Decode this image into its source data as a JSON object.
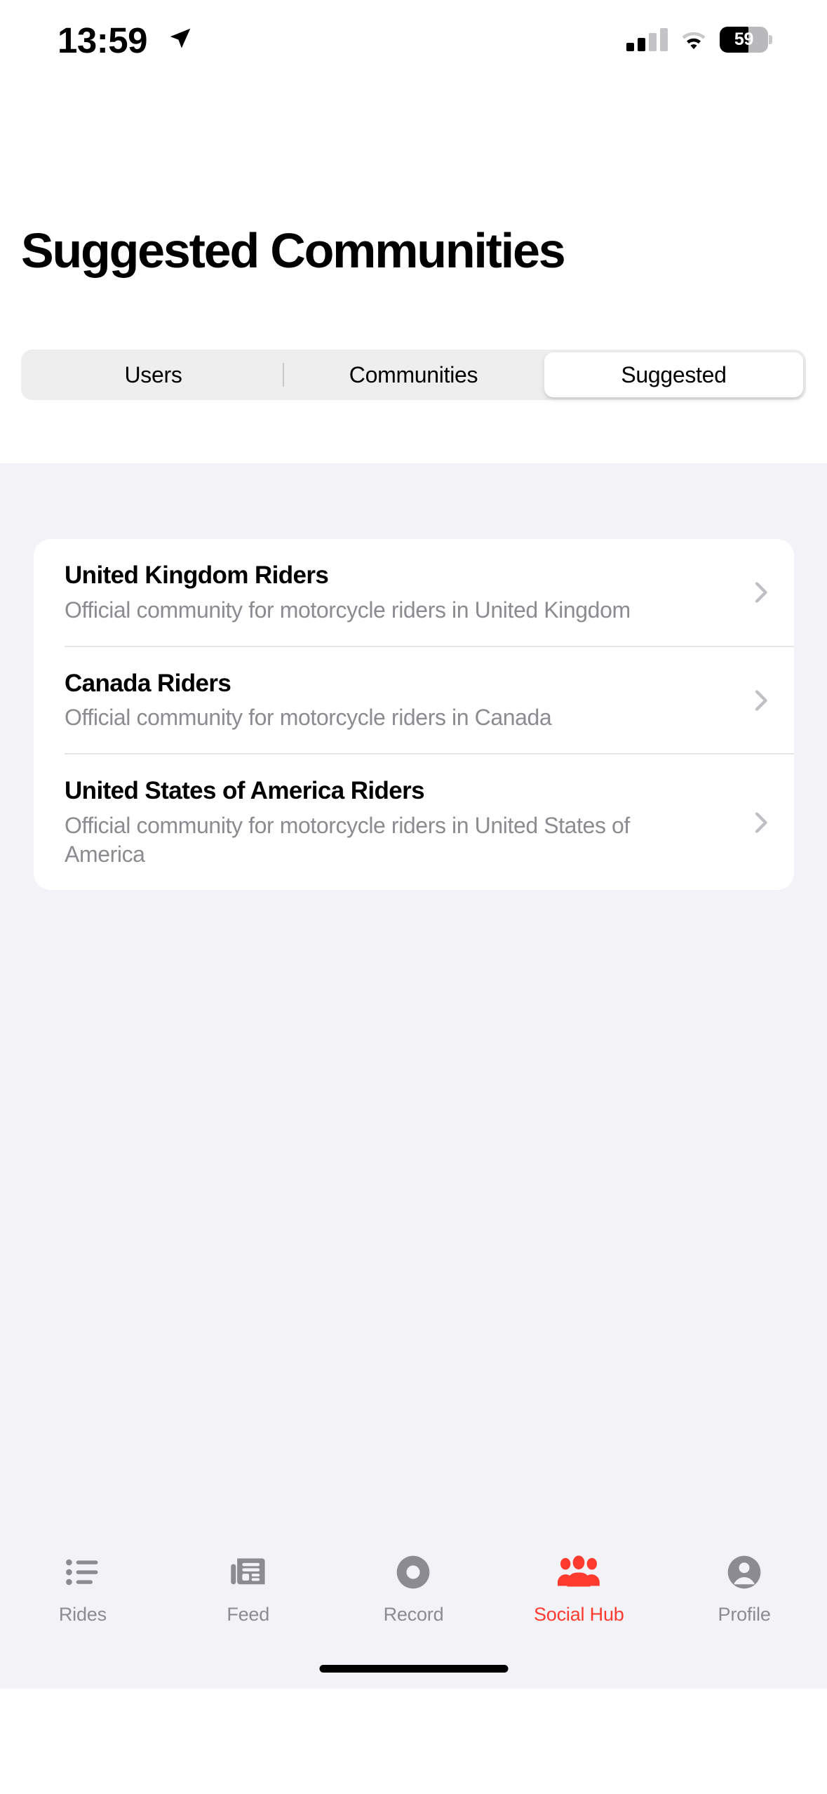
{
  "status_bar": {
    "time": "13:59",
    "location_icon": "location-arrow-icon",
    "cellular_icon": "cellular-signal-icon",
    "wifi_icon": "wifi-icon",
    "battery_percent": "59",
    "battery_level": 59
  },
  "header": {
    "title": "Suggested Communities"
  },
  "segmented_control": {
    "segments": [
      {
        "label": "Users",
        "active": false
      },
      {
        "label": "Communities",
        "active": false
      },
      {
        "label": "Suggested",
        "active": true
      }
    ]
  },
  "communities": [
    {
      "name": "United Kingdom Riders",
      "description": "Official community for motorcycle riders in United Kingdom",
      "chevron": "chevron-right-icon"
    },
    {
      "name": "Canada Riders",
      "description": "Official community for motorcycle riders in Canada",
      "chevron": "chevron-right-icon"
    },
    {
      "name": "United States of America Riders",
      "description": "Official community for motorcycle riders in United States of America",
      "chevron": "chevron-right-icon"
    }
  ],
  "tab_bar": {
    "active_color": "#ff3b30",
    "inactive_color": "#8b8b91",
    "tabs": [
      {
        "label": "Rides",
        "icon": "list-bullet-icon",
        "active": false
      },
      {
        "label": "Feed",
        "icon": "newspaper-icon",
        "active": false
      },
      {
        "label": "Record",
        "icon": "record-circle-icon",
        "active": false
      },
      {
        "label": "Social Hub",
        "icon": "people-group-icon",
        "active": true
      },
      {
        "label": "Profile",
        "icon": "person-circle-icon",
        "active": false
      }
    ]
  }
}
